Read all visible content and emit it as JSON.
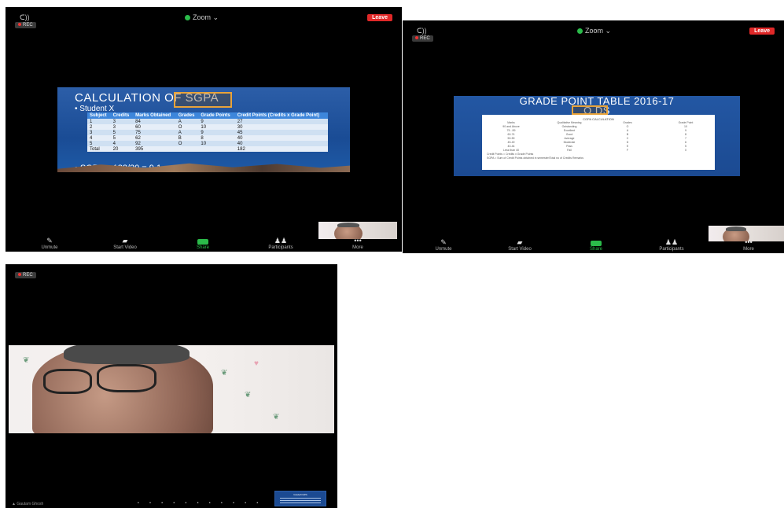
{
  "screens": [
    {
      "topbar": {
        "audio": "ᑕ))",
        "rec": "REC",
        "zoom": "Zoom ⌄",
        "leave": "Leave"
      },
      "slide": {
        "title": "CALCULATION OF SGPA",
        "subtitle": "• Student X",
        "headers": [
          "Subject",
          "Credits",
          "Marks Obtained",
          "Grades",
          "Grade Points",
          "Credit Points (Credits x Grade Point)"
        ],
        "rows": [
          [
            "1",
            "3",
            "84",
            "A",
            "9",
            "27"
          ],
          [
            "2",
            "3",
            "60",
            "O",
            "10",
            "30"
          ],
          [
            "3",
            "5",
            "75",
            "A",
            "9",
            "45"
          ],
          [
            "4",
            "5",
            "62",
            "B",
            "8",
            "40"
          ],
          [
            "5",
            "4",
            "92",
            "O",
            "10",
            "40"
          ],
          [
            "Total",
            "20",
            "395",
            "",
            "",
            "182"
          ]
        ],
        "footer": "• SGPA = 182/20 = 9.1"
      },
      "toolbar": [
        "Unmute",
        "Start Video",
        "Share",
        "Participants",
        "More"
      ]
    },
    {
      "topbar": {
        "audio": "ᑕ))",
        "rec": "REC",
        "zoom": "Zoom ⌄",
        "leave": "Leave"
      },
      "slide": {
        "title_line1": "GRADE POINT TABLE 2016-17",
        "title_line2": "O        DS",
        "doc_heading": "CGPA CALCULATION",
        "doc_headers": [
          "Marks",
          "Qualitative Meaning",
          "Grades",
          "Grade Point"
        ],
        "doc_rows": [
          [
            "90 and Above",
            "Outstanding",
            "O",
            "10"
          ],
          [
            "75 - 89",
            "Excellent",
            "A",
            "9"
          ],
          [
            "60-74",
            "Good",
            "B",
            "8"
          ],
          [
            "50-59",
            "Average",
            "C",
            "7"
          ],
          [
            "45-49",
            "Moderate",
            "D",
            "6"
          ],
          [
            "40-44",
            "Pass",
            "E",
            "5"
          ],
          [
            "Less than 40",
            "Fail",
            "F",
            "0"
          ]
        ],
        "doc_note1": "Credit Points = Credits x Grade Points",
        "doc_note2": "SGPA = Sum of Credit Points obtained in semester/Total no of Credits     Remarks"
      },
      "toolbar": [
        "Unmute",
        "Start Video",
        "Share",
        "Participants",
        "More"
      ]
    },
    {
      "rec": "REC",
      "pager": "• • • • • • • • • • •",
      "name": "▲ Gautam Ghosh",
      "mini_title": "Grade/CGPA"
    }
  ]
}
